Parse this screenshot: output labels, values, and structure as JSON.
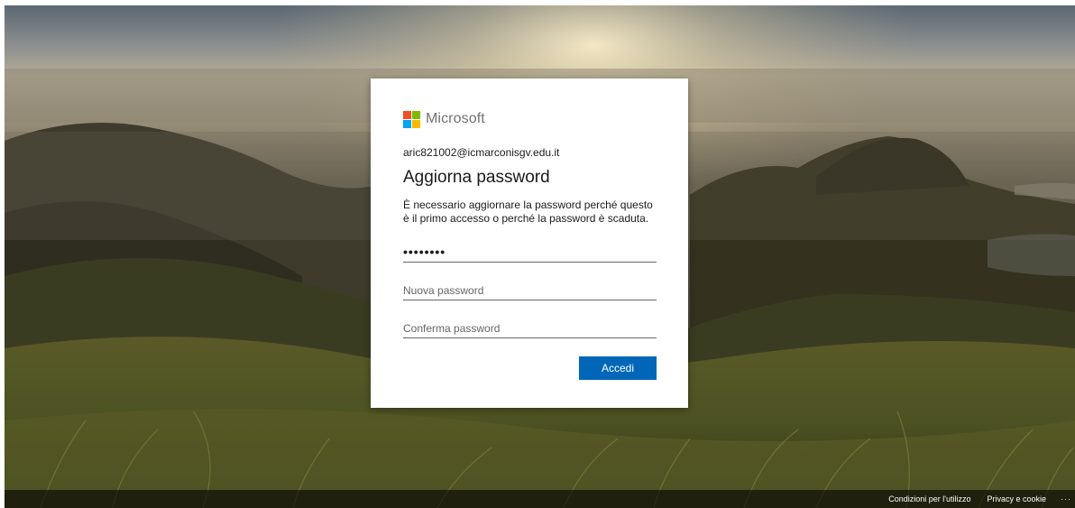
{
  "brand": {
    "name": "Microsoft",
    "logo_colors": [
      "#f25022",
      "#7fba00",
      "#00a4ef",
      "#ffb900"
    ]
  },
  "card": {
    "email": "aric821002@icmarconisgv.edu.it",
    "title": "Aggiorna password",
    "description": "È necessario aggiornare la password perché questo è il primo accesso o perché la password è scaduta.",
    "current_password_value": "••••••••",
    "new_password_placeholder": "Nuova password",
    "confirm_password_placeholder": "Conferma password",
    "submit_label": "Accedi"
  },
  "footer": {
    "terms": "Condizioni per l'utilizzo",
    "privacy": "Privacy e cookie",
    "more": "···"
  },
  "colors": {
    "button": "#0067b8",
    "text": "#1b1b1b"
  }
}
